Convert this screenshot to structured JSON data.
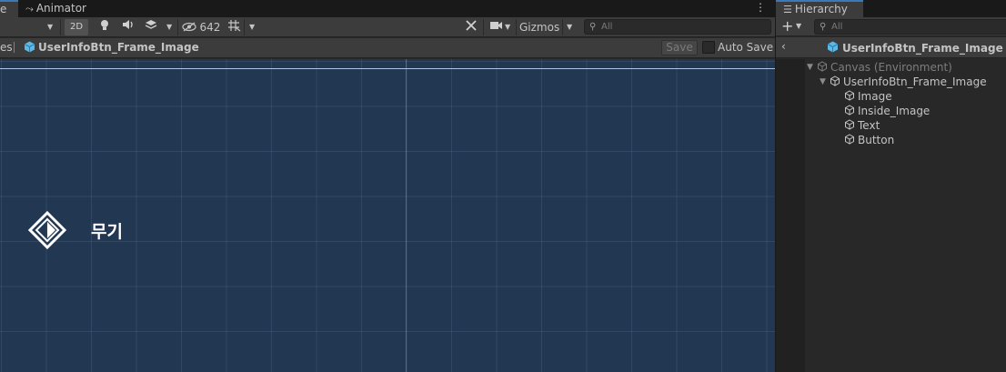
{
  "scene": {
    "tabs": [
      {
        "label": "e",
        "active": true
      },
      {
        "label": "Animator",
        "active": false
      }
    ],
    "toolbar": {
      "mode_2d_label": "2D",
      "hidden_count": "642",
      "gizmos_label": "Gizmos",
      "search_placeholder": "All"
    },
    "breadcrumb": {
      "previous": "es",
      "current": "UserInfoBtn_Frame_Image"
    },
    "save_label": "Save",
    "auto_save_label": "Auto Save",
    "canvas_text": "무기"
  },
  "hierarchy": {
    "tab_label": "Hierarchy",
    "search_placeholder": "All",
    "title": "UserInfoBtn_Frame_Image",
    "tree": [
      {
        "label": "Canvas (Environment)",
        "depth": 0,
        "expanded": true,
        "dim": true
      },
      {
        "label": "UserInfoBtn_Frame_Image",
        "depth": 1,
        "expanded": true,
        "dim": false
      },
      {
        "label": "Image",
        "depth": 2,
        "expanded": false,
        "dim": false
      },
      {
        "label": "Inside_Image",
        "depth": 2,
        "expanded": false,
        "dim": false
      },
      {
        "label": "Text",
        "depth": 2,
        "expanded": false,
        "dim": false
      },
      {
        "label": "Button",
        "depth": 2,
        "expanded": false,
        "dim": false
      }
    ]
  },
  "colors": {
    "viewport_bg": "#213752",
    "accent_blue": "#3a79bb",
    "prefab_icon": "#5db8e6"
  }
}
